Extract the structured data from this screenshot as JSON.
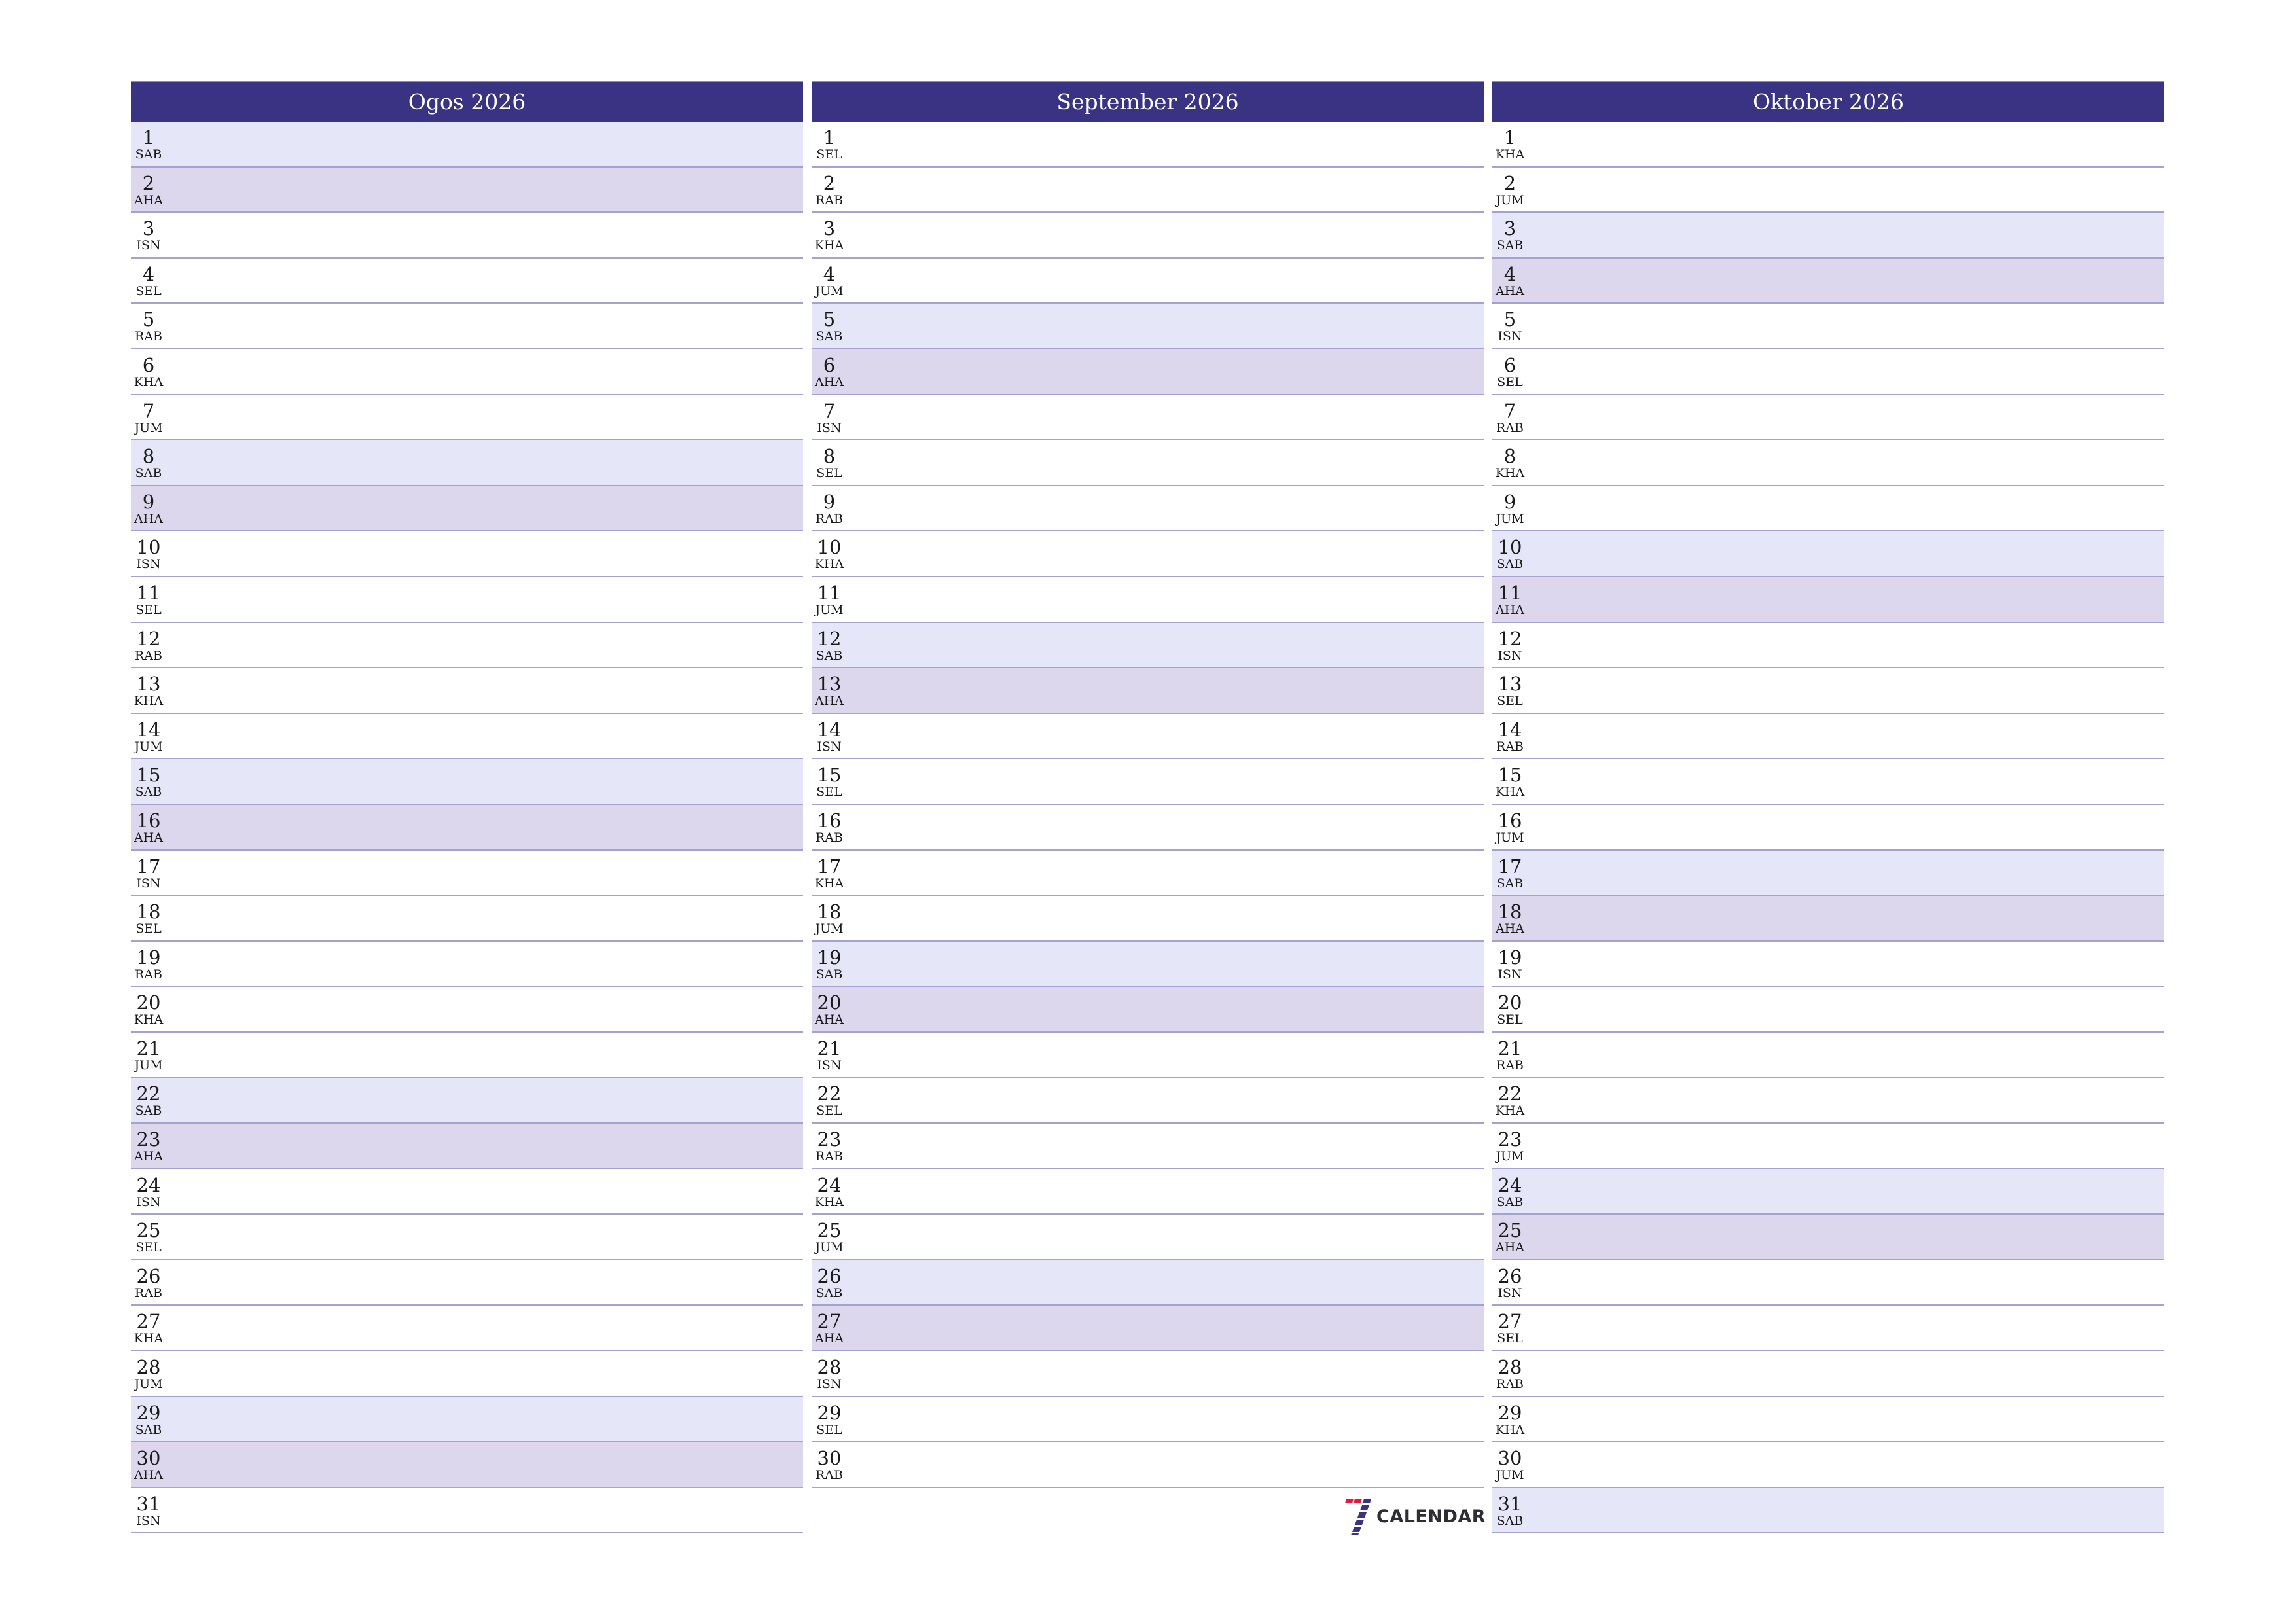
{
  "colors": {
    "header": "#3a3384",
    "saturday_row": "#e5e6f8",
    "sunday_row": "#dcd7ed",
    "row_border": "#a6a2cf",
    "logo_red": "#e8173f",
    "logo_indigo": "#3a3384"
  },
  "months": [
    {
      "title": "Ogos 2026",
      "days": [
        {
          "num": "1",
          "name": "SAB"
        },
        {
          "num": "2",
          "name": "AHA"
        },
        {
          "num": "3",
          "name": "ISN"
        },
        {
          "num": "4",
          "name": "SEL"
        },
        {
          "num": "5",
          "name": "RAB"
        },
        {
          "num": "6",
          "name": "KHA"
        },
        {
          "num": "7",
          "name": "JUM"
        },
        {
          "num": "8",
          "name": "SAB"
        },
        {
          "num": "9",
          "name": "AHA"
        },
        {
          "num": "10",
          "name": "ISN"
        },
        {
          "num": "11",
          "name": "SEL"
        },
        {
          "num": "12",
          "name": "RAB"
        },
        {
          "num": "13",
          "name": "KHA"
        },
        {
          "num": "14",
          "name": "JUM"
        },
        {
          "num": "15",
          "name": "SAB"
        },
        {
          "num": "16",
          "name": "AHA"
        },
        {
          "num": "17",
          "name": "ISN"
        },
        {
          "num": "18",
          "name": "SEL"
        },
        {
          "num": "19",
          "name": "RAB"
        },
        {
          "num": "20",
          "name": "KHA"
        },
        {
          "num": "21",
          "name": "JUM"
        },
        {
          "num": "22",
          "name": "SAB"
        },
        {
          "num": "23",
          "name": "AHA"
        },
        {
          "num": "24",
          "name": "ISN"
        },
        {
          "num": "25",
          "name": "SEL"
        },
        {
          "num": "26",
          "name": "RAB"
        },
        {
          "num": "27",
          "name": "KHA"
        },
        {
          "num": "28",
          "name": "JUM"
        },
        {
          "num": "29",
          "name": "SAB"
        },
        {
          "num": "30",
          "name": "AHA"
        },
        {
          "num": "31",
          "name": "ISN"
        }
      ]
    },
    {
      "title": "September 2026",
      "days": [
        {
          "num": "1",
          "name": "SEL"
        },
        {
          "num": "2",
          "name": "RAB"
        },
        {
          "num": "3",
          "name": "KHA"
        },
        {
          "num": "4",
          "name": "JUM"
        },
        {
          "num": "5",
          "name": "SAB"
        },
        {
          "num": "6",
          "name": "AHA"
        },
        {
          "num": "7",
          "name": "ISN"
        },
        {
          "num": "8",
          "name": "SEL"
        },
        {
          "num": "9",
          "name": "RAB"
        },
        {
          "num": "10",
          "name": "KHA"
        },
        {
          "num": "11",
          "name": "JUM"
        },
        {
          "num": "12",
          "name": "SAB"
        },
        {
          "num": "13",
          "name": "AHA"
        },
        {
          "num": "14",
          "name": "ISN"
        },
        {
          "num": "15",
          "name": "SEL"
        },
        {
          "num": "16",
          "name": "RAB"
        },
        {
          "num": "17",
          "name": "KHA"
        },
        {
          "num": "18",
          "name": "JUM"
        },
        {
          "num": "19",
          "name": "SAB"
        },
        {
          "num": "20",
          "name": "AHA"
        },
        {
          "num": "21",
          "name": "ISN"
        },
        {
          "num": "22",
          "name": "SEL"
        },
        {
          "num": "23",
          "name": "RAB"
        },
        {
          "num": "24",
          "name": "KHA"
        },
        {
          "num": "25",
          "name": "JUM"
        },
        {
          "num": "26",
          "name": "SAB"
        },
        {
          "num": "27",
          "name": "AHA"
        },
        {
          "num": "28",
          "name": "ISN"
        },
        {
          "num": "29",
          "name": "SEL"
        },
        {
          "num": "30",
          "name": "RAB"
        }
      ]
    },
    {
      "title": "Oktober 2026",
      "days": [
        {
          "num": "1",
          "name": "KHA"
        },
        {
          "num": "2",
          "name": "JUM"
        },
        {
          "num": "3",
          "name": "SAB"
        },
        {
          "num": "4",
          "name": "AHA"
        },
        {
          "num": "5",
          "name": "ISN"
        },
        {
          "num": "6",
          "name": "SEL"
        },
        {
          "num": "7",
          "name": "RAB"
        },
        {
          "num": "8",
          "name": "KHA"
        },
        {
          "num": "9",
          "name": "JUM"
        },
        {
          "num": "10",
          "name": "SAB"
        },
        {
          "num": "11",
          "name": "AHA"
        },
        {
          "num": "12",
          "name": "ISN"
        },
        {
          "num": "13",
          "name": "SEL"
        },
        {
          "num": "14",
          "name": "RAB"
        },
        {
          "num": "15",
          "name": "KHA"
        },
        {
          "num": "16",
          "name": "JUM"
        },
        {
          "num": "17",
          "name": "SAB"
        },
        {
          "num": "18",
          "name": "AHA"
        },
        {
          "num": "19",
          "name": "ISN"
        },
        {
          "num": "20",
          "name": "SEL"
        },
        {
          "num": "21",
          "name": "RAB"
        },
        {
          "num": "22",
          "name": "KHA"
        },
        {
          "num": "23",
          "name": "JUM"
        },
        {
          "num": "24",
          "name": "SAB"
        },
        {
          "num": "25",
          "name": "AHA"
        },
        {
          "num": "26",
          "name": "ISN"
        },
        {
          "num": "27",
          "name": "SEL"
        },
        {
          "num": "28",
          "name": "RAB"
        },
        {
          "num": "29",
          "name": "KHA"
        },
        {
          "num": "30",
          "name": "JUM"
        },
        {
          "num": "31",
          "name": "SAB"
        }
      ]
    }
  ],
  "weekend": {
    "saturday": "SAB",
    "sunday": "AHA"
  },
  "logo": {
    "text": "CALENDAR",
    "icon": "seven-logo-icon"
  }
}
